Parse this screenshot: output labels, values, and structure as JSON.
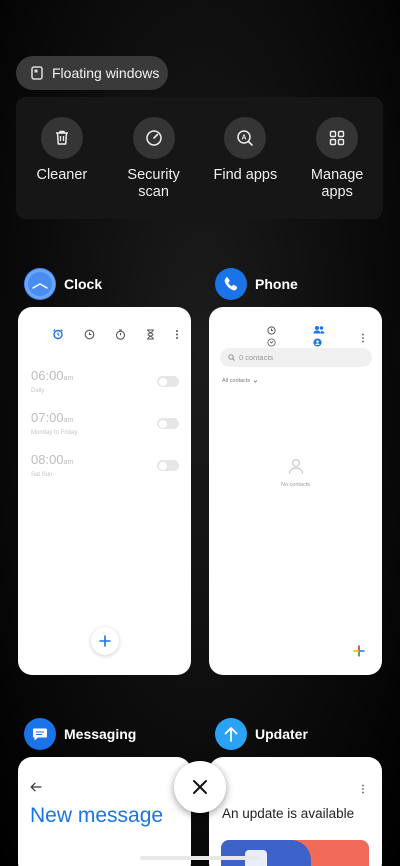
{
  "floating_windows": {
    "label": "Floating windows"
  },
  "quick_actions": [
    {
      "label": "Cleaner",
      "icon": "trash-icon"
    },
    {
      "label": "Security scan",
      "icon": "shield-gauge-icon"
    },
    {
      "label": "Find apps",
      "icon": "search-apps-icon"
    },
    {
      "label": "Manage apps",
      "icon": "grid-icon"
    }
  ],
  "recent_apps": {
    "clock": {
      "name": "Clock",
      "alarms": [
        {
          "time": "06:00",
          "ampm": "am",
          "repeat": "Daily"
        },
        {
          "time": "07:00",
          "ampm": "am",
          "repeat": "Monday to Friday"
        },
        {
          "time": "08:00",
          "ampm": "am",
          "repeat": "Sat Sun"
        }
      ]
    },
    "phone": {
      "name": "Phone",
      "search_placeholder": "0 contacts",
      "filter_label": "All contacts",
      "empty_label": "No contacts"
    },
    "messaging": {
      "name": "Messaging",
      "title": "New message"
    },
    "updater": {
      "name": "Updater",
      "title": "An update is available"
    }
  },
  "colors": {
    "accent_blue": "#1a73e8",
    "clock_icon": "#4a8df0",
    "updater_blue": "#2aa3f4",
    "update_banner": "#f26a5a"
  }
}
